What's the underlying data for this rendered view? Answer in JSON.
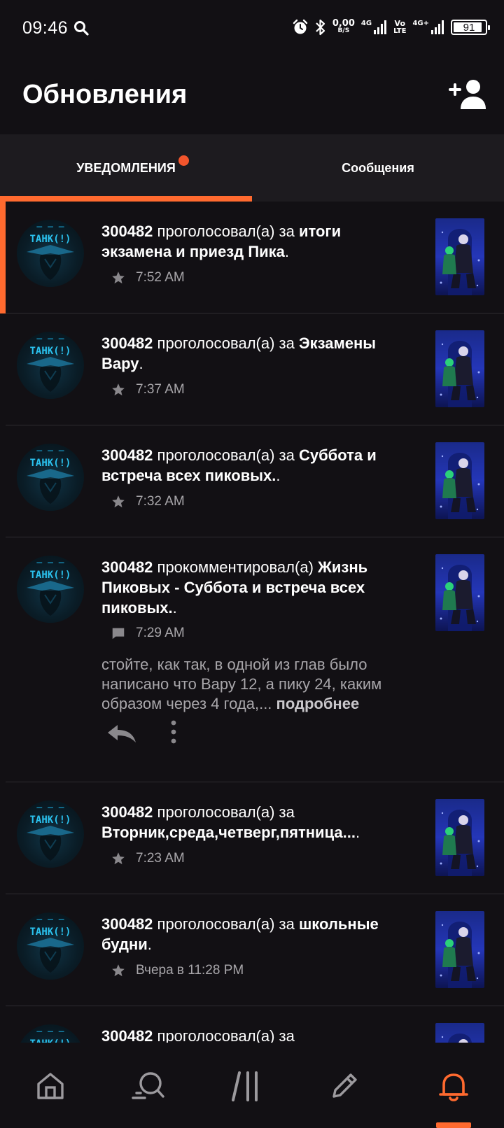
{
  "status_bar": {
    "time": "09:46",
    "net_speed_value": "0,00",
    "net_speed_unit": "B/S",
    "net_4g_1": "4G",
    "volte_top": "Vo",
    "volte_bottom": "LTE",
    "net_4g_2": "4G+",
    "battery": "91",
    "battery_level": 0.91
  },
  "header": {
    "title": "Обновления"
  },
  "tabs": [
    {
      "label": "УВЕДОМЛЕНИЯ",
      "active": true,
      "has_dot": true
    },
    {
      "label": "Сообщения",
      "active": false,
      "has_dot": false
    }
  ],
  "notifications": [
    {
      "user": "300482",
      "action": " проголосовал(а) за ",
      "target": "итоги экзамена и приезд Пика",
      "suffix": ".",
      "type": "vote",
      "time": "7:52 AM",
      "unread": true
    },
    {
      "user": "300482",
      "action": " проголосовал(а) за ",
      "target": "Экзамены Вару",
      "suffix": ".",
      "type": "vote",
      "time": "7:37 AM",
      "unread": false
    },
    {
      "user": "300482",
      "action": " проголосовал(а) за ",
      "target": "Суббота и встреча всех пиковых.",
      "suffix": ".",
      "type": "vote",
      "time": "7:32 AM",
      "unread": false
    },
    {
      "user": "300482",
      "action": " прокомментировал(а) ",
      "target": "Жизнь Пиковых - Суббота и встреча всех пиковых.",
      "suffix": ".",
      "type": "comment",
      "time": "7:29 AM",
      "unread": false,
      "comment_text": "стойте, как так, в одной из глав было написано что Вару 12, а пику 24, каким образом через 4 года,...",
      "more_label": "подробнее"
    },
    {
      "user": "300482",
      "action": " проголосовал(а) за ",
      "target": "Вторник,среда,четверг,пятница...",
      "suffix": ".",
      "type": "vote",
      "time": "7:23 AM",
      "unread": false
    },
    {
      "user": "300482",
      "action": " проголосовал(а) за ",
      "target": "школьные будни",
      "suffix": ".",
      "type": "vote",
      "time": "Вчера в 11:28 PM",
      "unread": false
    },
    {
      "user": "300482",
      "action": " проголосовал(а) за",
      "target": "",
      "suffix": "",
      "type": "vote",
      "time": "",
      "unread": false
    }
  ],
  "avatar_text": "ТАНК(!)",
  "icons": {
    "vote": "star-icon",
    "comment": "comment-icon",
    "reply": "reply-icon",
    "more": "more-vertical-icon"
  },
  "bottom_nav": [
    {
      "name": "home-icon",
      "active": false
    },
    {
      "name": "discover-icon",
      "active": false
    },
    {
      "name": "library-icon",
      "active": false
    },
    {
      "name": "write-icon",
      "active": false
    },
    {
      "name": "bell-icon",
      "active": true
    }
  ],
  "colors": {
    "accent": "#ff6a2f",
    "badge": "#f2552c",
    "background": "#121014",
    "tab_bar": "#1d1b1f",
    "muted_text": "#a8a6aa"
  }
}
